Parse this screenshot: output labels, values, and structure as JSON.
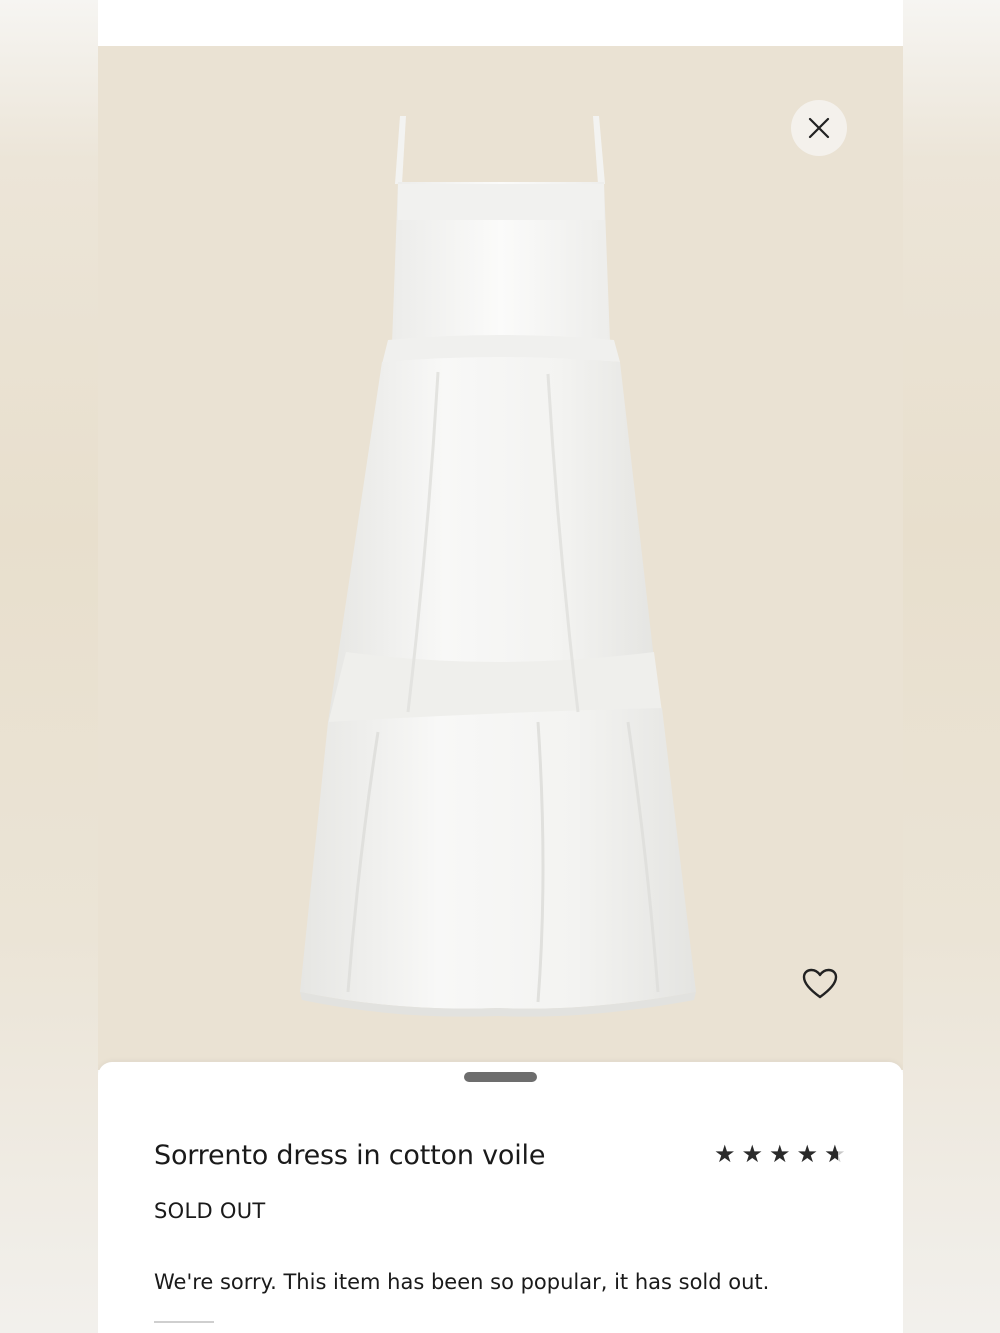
{
  "product": {
    "name": "Sorrento dress in cotton voile",
    "status": "SOLD OUT",
    "message": "We're sorry. This item has been so popular, it has sold out.",
    "rating": 4.5,
    "rating_max": 5
  },
  "icons": {
    "close": "close-icon",
    "favorite": "heart-outline-icon",
    "star": "star-icon"
  },
  "colors": {
    "image_background": "#eae2d3",
    "text": "#1a1a1a",
    "handle": "#6d6d6d"
  }
}
